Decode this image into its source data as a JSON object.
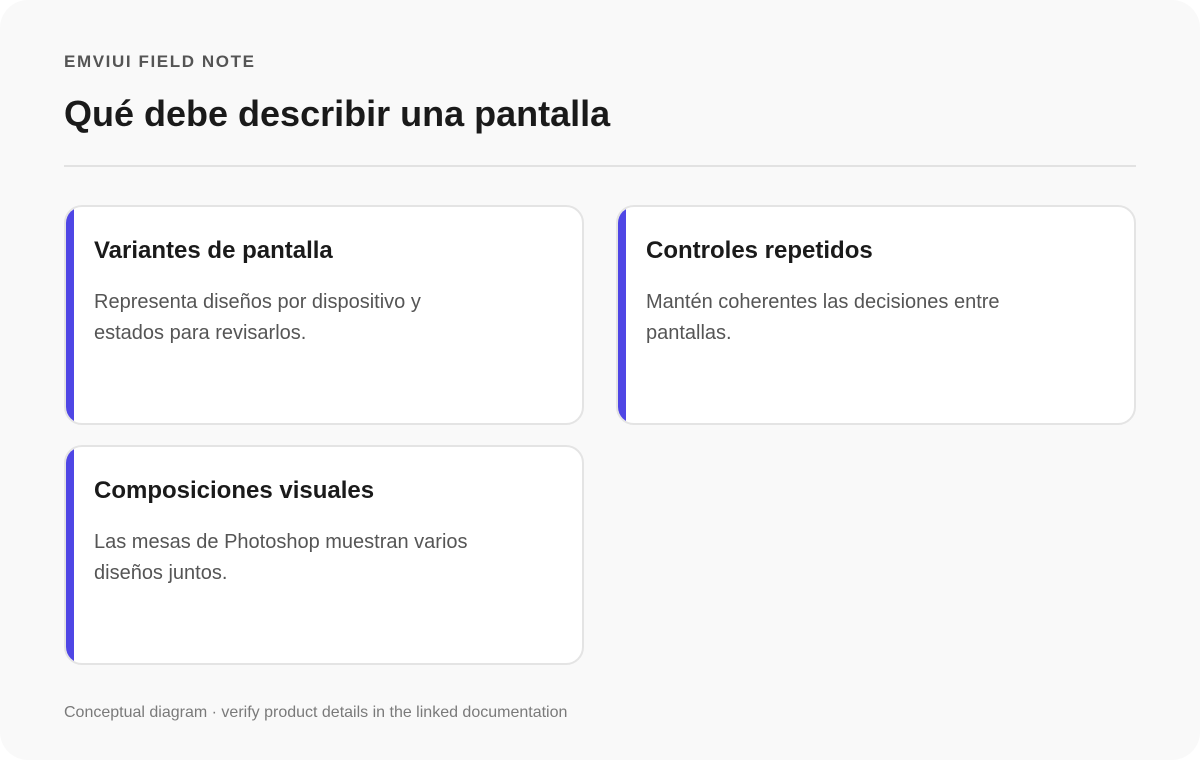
{
  "header": {
    "eyebrow": "EMVIUI FIELD NOTE",
    "title": "Qué debe describir una pantalla"
  },
  "cards": [
    {
      "title": "Variantes de pantalla",
      "body": "Representa diseños por dispositivo y estados para revisarlos."
    },
    {
      "title": "Controles repetidos",
      "body": "Mantén coherentes las decisiones entre pantallas."
    },
    {
      "title": "Composiciones visuales",
      "body": "Las mesas de Photoshop muestran varios diseños juntos."
    }
  ],
  "footer": {
    "note": "Conceptual diagram · verify product details in the linked documentation"
  },
  "colors": {
    "accent": "#4f46e5",
    "background": "#f9f9f9",
    "card": "#ffffff"
  }
}
